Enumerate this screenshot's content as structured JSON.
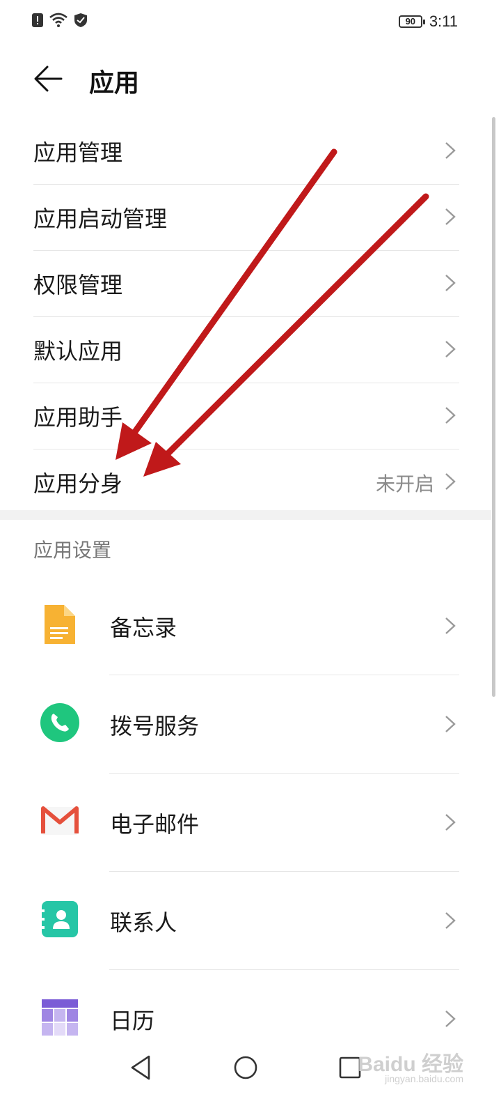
{
  "status_bar": {
    "icons": [
      "alert-icon",
      "wifi-icon",
      "shield-icon"
    ],
    "battery_level": "90",
    "time": "3:11"
  },
  "header": {
    "title": "应用"
  },
  "menu": [
    {
      "label": "应用管理",
      "value": ""
    },
    {
      "label": "应用启动管理",
      "value": ""
    },
    {
      "label": "权限管理",
      "value": ""
    },
    {
      "label": "默认应用",
      "value": ""
    },
    {
      "label": "应用助手",
      "value": ""
    },
    {
      "label": "应用分身",
      "value": "未开启"
    }
  ],
  "section": {
    "title": "应用设置"
  },
  "apps": [
    {
      "label": "备忘录",
      "icon": "notes-icon",
      "color": "#F7B233"
    },
    {
      "label": "拨号服务",
      "icon": "phone-icon",
      "color": "#1FC67E"
    },
    {
      "label": "电子邮件",
      "icon": "mail-icon",
      "color": "#E5503C"
    },
    {
      "label": "联系人",
      "icon": "contacts-icon",
      "color": "#26C6A6"
    },
    {
      "label": "日历",
      "icon": "calendar-icon",
      "color": "#7B5CD6"
    }
  ],
  "annotation_color": "#C0191A",
  "watermark": {
    "brand": "Baidu 经验",
    "url": "jingyan.baidu.com"
  }
}
